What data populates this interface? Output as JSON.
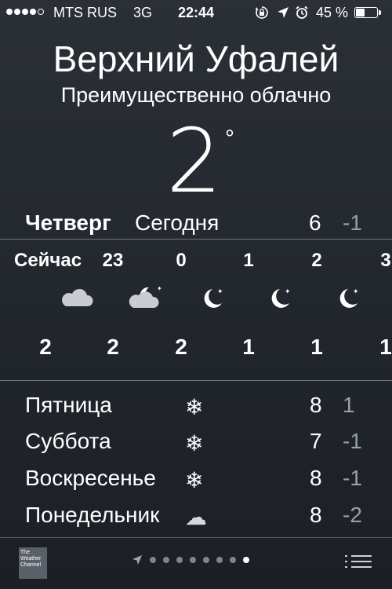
{
  "status_bar": {
    "carrier": "MTS RUS",
    "network": "3G",
    "time": "22:44",
    "battery_percent": "45 %",
    "battery_level": 0.45,
    "icons": [
      "rotation-lock-icon",
      "location-arrow-icon",
      "alarm-icon"
    ]
  },
  "location": {
    "city": "Верхний Уфалей",
    "condition": "Преимущественно облачно",
    "temperature": "2",
    "degree_symbol": "°"
  },
  "today": {
    "day": "Четверг",
    "label": "Сегодня",
    "high": "6",
    "low": "-1"
  },
  "hourly": [
    {
      "time": "Сейчас",
      "icon": "cloud-icon",
      "temp": "2"
    },
    {
      "time": "23",
      "icon": "partly-cloudy-night-icon",
      "temp": "2"
    },
    {
      "time": "0",
      "icon": "moon-stars-icon",
      "temp": "2"
    },
    {
      "time": "1",
      "icon": "moon-stars-icon",
      "temp": "1"
    },
    {
      "time": "2",
      "icon": "moon-stars-icon",
      "temp": "1"
    },
    {
      "time": "3",
      "icon": "moon-stars-icon",
      "temp": "1"
    }
  ],
  "daily": [
    {
      "day": "Пятница",
      "icon": "snowflake-icon",
      "glyph": "❄",
      "high": "8",
      "low": "1"
    },
    {
      "day": "Суббота",
      "icon": "snowflake-icon",
      "glyph": "❄",
      "high": "7",
      "low": "-1"
    },
    {
      "day": "Воскресенье",
      "icon": "snowflake-icon",
      "glyph": "❄",
      "high": "8",
      "low": "-1"
    },
    {
      "day": "Понедельник",
      "icon": "cloud-icon",
      "glyph": "☁",
      "high": "8",
      "low": "-2"
    }
  ],
  "bottom_bar": {
    "logo_text": "The Weather Channel",
    "page_count": 9,
    "active_page": 9
  },
  "colors": {
    "background_top": "#2b2f36",
    "background_bottom": "#1c1f25",
    "low_temp": "#9aa0a8",
    "text": "#ffffff"
  }
}
